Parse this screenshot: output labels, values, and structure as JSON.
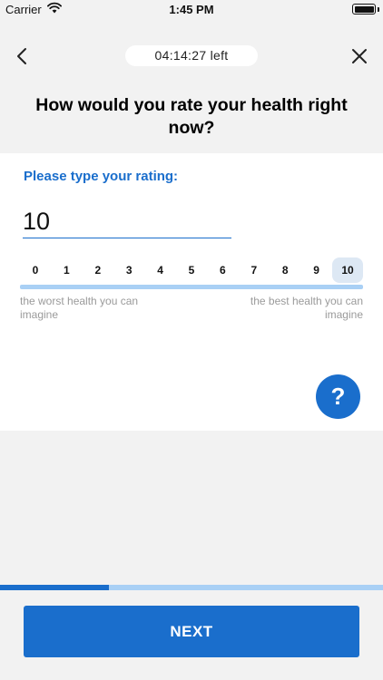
{
  "status_bar": {
    "carrier": "Carrier",
    "time": "1:45 PM"
  },
  "header": {
    "timer": "04:14:27 left"
  },
  "question": "How would you rate your health right now?",
  "rating": {
    "prompt": "Please type your rating:",
    "value": "10",
    "scale": [
      "0",
      "1",
      "2",
      "3",
      "4",
      "5",
      "6",
      "7",
      "8",
      "9",
      "10"
    ],
    "selected_index": 10,
    "min_label": "the worst health you can imagine",
    "max_label": "the best health you can imagine"
  },
  "help": {
    "label": "?"
  },
  "progress": {
    "fraction": 0.285
  },
  "footer": {
    "next_label": "NEXT"
  },
  "colors": {
    "accent": "#1a6ecc",
    "accent_light": "#a9d0f5",
    "background": "#f2f2f2"
  }
}
